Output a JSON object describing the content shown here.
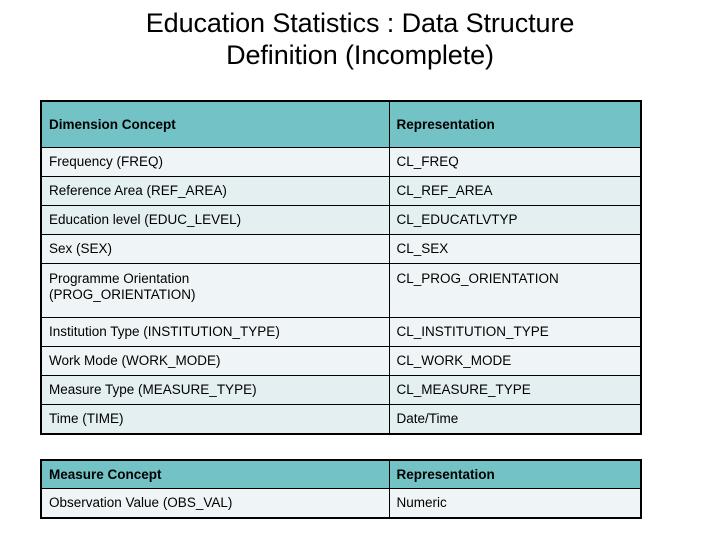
{
  "slide": {
    "title_lines": [
      "Education Statistics : Data Structure",
      "Definition (Incomplete)"
    ],
    "colors": {
      "header_fill": "#72C2C6",
      "row_fill_light": "#EFF5F6",
      "row_fill_alt": "#E3EFF0",
      "border": "#000000",
      "background": "#FFFFFF",
      "text": "#000000"
    }
  },
  "dimension_table": {
    "headers": [
      "Dimension Concept",
      "Representation"
    ],
    "rows": [
      {
        "concept": "Frequency (FREQ)",
        "representation": "CL_FREQ"
      },
      {
        "concept": "Reference Area (REF_AREA)",
        "representation": "CL_REF_AREA"
      },
      {
        "concept": "Education level (EDUC_LEVEL)",
        "representation": "CL_EDUCATLVTYP"
      },
      {
        "concept": "Sex (SEX)",
        "representation": "CL_SEX"
      },
      {
        "concept": "Programme Orientation (PROG_ORIENTATION)",
        "concept_line1": "Programme Orientation",
        "concept_line2": "(PROG_ORIENTATION)",
        "representation": "CL_PROG_ORIENTATION"
      },
      {
        "concept": "Institution Type (INSTITUTION_TYPE)",
        "representation": "CL_INSTITUTION_TYPE"
      },
      {
        "concept": "Work Mode (WORK_MODE)",
        "representation": "CL_WORK_MODE"
      },
      {
        "concept": "Measure Type (MEASURE_TYPE)",
        "representation": "CL_MEASURE_TYPE"
      },
      {
        "concept": "Time (TIME)",
        "representation": "Date/Time"
      }
    ]
  },
  "measure_table": {
    "headers": [
      "Measure Concept",
      "Representation"
    ],
    "rows": [
      {
        "concept": "Observation Value (OBS_VAL)",
        "representation": "Numeric"
      }
    ]
  }
}
